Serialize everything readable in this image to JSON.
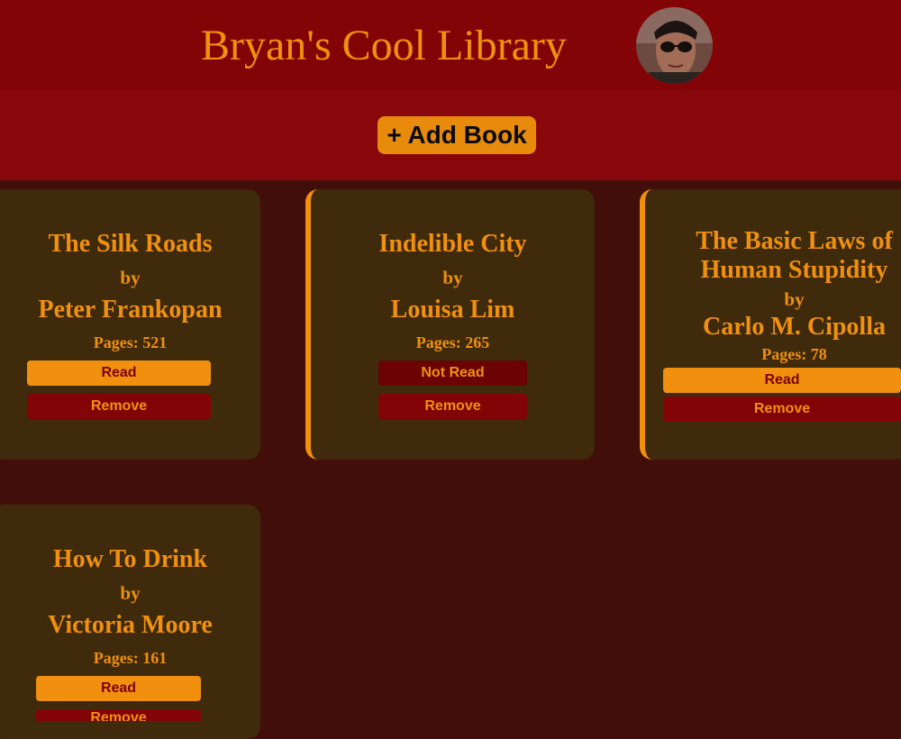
{
  "header": {
    "title": "Bryan's Cool Library"
  },
  "toolbar": {
    "add_label": "+ Add Book"
  },
  "books": [
    {
      "title": "The Silk Roads",
      "by": "by",
      "author": "Peter Frankopan",
      "pages": "Pages: 521",
      "status": "Read",
      "remove": "Remove"
    },
    {
      "title": "Indelible City",
      "by": "by",
      "author": "Louisa Lim",
      "pages": "Pages: 265",
      "status": "Not Read",
      "remove": "Remove"
    },
    {
      "title_line1": "The Basic Laws of",
      "title_line2": "Human Stupidity",
      "by": "by",
      "author": "Carlo M. Cipolla",
      "pages": "Pages: 78",
      "status": "Read",
      "remove": "Remove"
    },
    {
      "title": "How To Drink",
      "by": "by",
      "author": "Victoria Moore",
      "pages": "Pages: 161",
      "status": "Read",
      "remove": "Remove"
    }
  ],
  "colors": {
    "page_bg": "#420e0a",
    "header_bg": "#830406",
    "toolbar_bg": "#88070b",
    "card_bg": "#3f2a0b",
    "accent_orange": "#f0900e",
    "dark_red": "#830406"
  },
  "icons": {
    "avatar": "user-photo"
  }
}
